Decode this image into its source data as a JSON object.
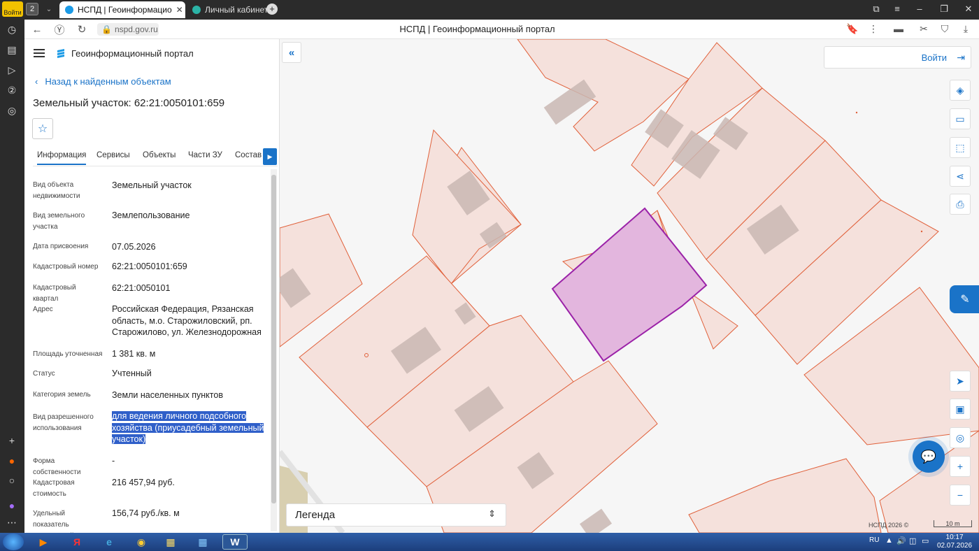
{
  "browser": {
    "login_badge": "Войти",
    "tab_count": "2",
    "active_tab_title": "НСПД | Геоинформацио",
    "inactive_tab_title": "Личный кабинет",
    "url": "nspd.gov.ru",
    "page_title": "НСПД | Геоинформационный портал"
  },
  "panel": {
    "portal_title": "Геоинформационный портал",
    "back_link": "Назад к найденным объектам",
    "object_title": "Земельный участок: 62:21:0050101:659",
    "tabs": [
      "Информация",
      "Сервисы",
      "Объекты",
      "Части ЗУ",
      "Состав"
    ],
    "rows": [
      {
        "label": "Вид объекта недвижимости",
        "value": "Земельный участок"
      },
      {
        "label": "Вид земельного участка",
        "value": "Землепользование"
      },
      {
        "label": "Дата присвоения",
        "value": "07.05.2026"
      },
      {
        "label": "Кадастровый номер",
        "value": "62:21:0050101:659"
      },
      {
        "label": "Кадастровый квартал",
        "value": "62:21:0050101"
      },
      {
        "label": "Адрес",
        "value": "Российская Федерация, Рязанская область, м.о. Старожиловский, рп. Старожилово, ул. Железнодорожная"
      },
      {
        "label": "Площадь уточненная",
        "value": "1 381 кв. м"
      },
      {
        "label": "Статус",
        "value": "Учтенный"
      },
      {
        "label": "Категория земель",
        "value": "Земли населенных пунктов"
      },
      {
        "label": "Вид разрешенного использования",
        "value": "для ведения личного подсобного хозяйства (приусадебный земельный участок)"
      },
      {
        "label": "Форма собственности",
        "value": "-"
      },
      {
        "label": "Кадастровая стоимость",
        "value": "216 457,94 руб."
      },
      {
        "label": "Удельный показатель кадастровой",
        "value": "156,74 руб./кв. м"
      }
    ]
  },
  "map": {
    "login_label": "Войти",
    "legend_label": "Легенда",
    "credit": "НСПД 2026 ©",
    "scale": "10 m",
    "colors": {
      "parcel_fill": "#f5e1dc",
      "parcel_stroke": "#e0603a",
      "selected_fill": "#e3b6de",
      "selected_stroke": "#9b22a8",
      "accent": "#1a73c8"
    }
  },
  "taskbar": {
    "lang": "RU",
    "time": "10:17",
    "date": "02.07.2026"
  }
}
